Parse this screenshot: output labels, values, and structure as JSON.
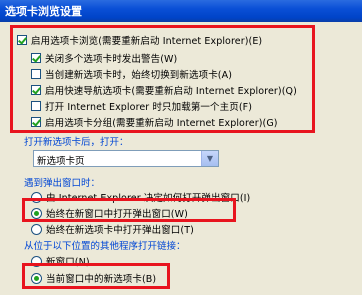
{
  "window": {
    "title": "选项卡浏览设置"
  },
  "main_checkbox": {
    "label": "启用选项卡浏览(需要重新启动 Internet Explorer)(E)",
    "checked": true
  },
  "options": [
    {
      "label": "关闭多个选项卡时发出警告(W)",
      "checked": true
    },
    {
      "label": "当创建新选项卡时，始终切换到新选项卡(A)",
      "checked": false
    },
    {
      "label": "启用快速导航选项卡(需要重新启动 Internet Explorer)(Q)",
      "checked": true
    },
    {
      "label": "打开 Internet Explorer 时只加载第一个主页(F)",
      "checked": false
    },
    {
      "label": "启用选项卡分组(需要重新启动 Internet Explorer)(G)",
      "checked": true
    }
  ],
  "new_tab": {
    "heading": "打开新选项卡后，打开：",
    "selected": "新选项卡页"
  },
  "popup": {
    "heading": "遇到弹出窗口时：",
    "options": [
      {
        "label": "由 Internet Explorer 决定如何打开弹出窗口(I)",
        "checked": false
      },
      {
        "label": "始终在新窗口中打开弹出窗口(W)",
        "checked": true
      },
      {
        "label": "始终在新选项卡中打开弹出窗口(T)",
        "checked": false
      }
    ]
  },
  "external_links": {
    "heading": "从位于以下位置的其他程序打开链接：",
    "options": [
      {
        "label": "新窗口(N)",
        "checked": false
      },
      {
        "label": "当前窗口中的新选项卡(B)",
        "checked": true
      }
    ]
  }
}
